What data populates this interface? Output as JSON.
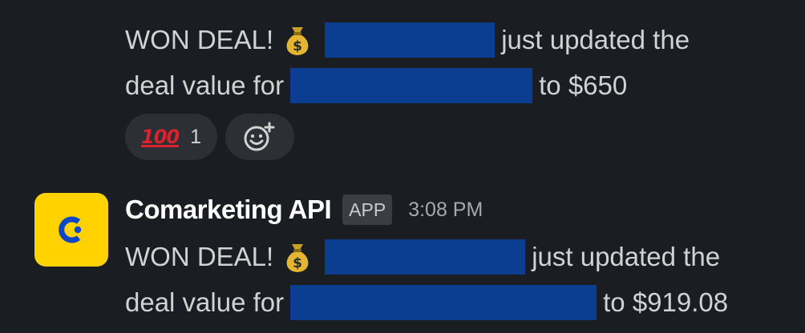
{
  "messages": [
    {
      "line1_prefix": "WON DEAL!",
      "line1_suffix": "just updated the",
      "line2_prefix": "deal value for",
      "line2_suffix": "to $650",
      "reactions": [
        {
          "emoji": "100",
          "count": "1"
        }
      ]
    },
    {
      "sender": "Comarketing API",
      "badge": "APP",
      "time": "3:08 PM",
      "line1_prefix": "WON DEAL!",
      "line1_suffix": "just updated the",
      "line2_prefix": "deal value for",
      "line2_suffix": "to $919.08"
    }
  ],
  "icons": {
    "money_bag": "money-bag-icon",
    "add_reaction": "add-reaction-icon",
    "avatar_logo": "comarketing-logo"
  },
  "colors": {
    "background": "#1a1d21",
    "avatar": "#ffd200",
    "logo": "#0d47c9",
    "redaction": "#0b3d91"
  }
}
